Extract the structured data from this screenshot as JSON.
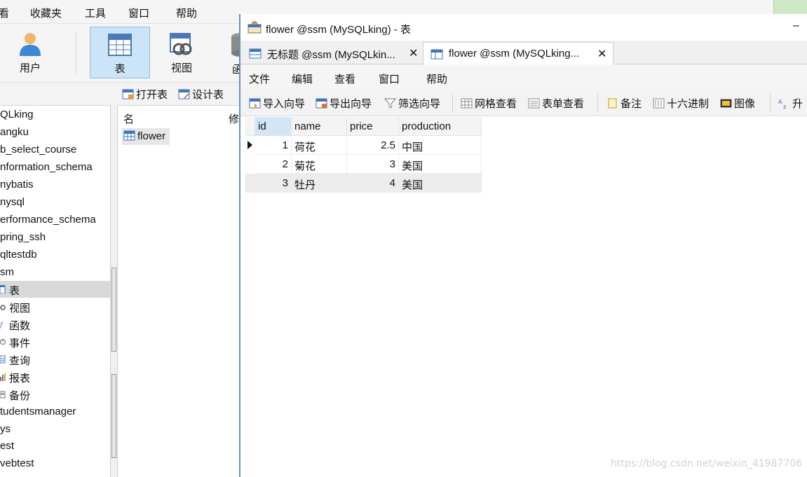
{
  "main_menu": [
    "看",
    "收藏夹",
    "工具",
    "窗口",
    "帮助"
  ],
  "main_toolbar": {
    "buttons": [
      {
        "label": "用户",
        "icon": "user-icon"
      },
      {
        "label": "表",
        "icon": "table-icon"
      },
      {
        "label": "视图",
        "icon": "view-icon"
      },
      {
        "label": "函",
        "icon": "function-icon"
      }
    ]
  },
  "sub_toolbar": {
    "open_table": "打开表",
    "design_table": "设计表"
  },
  "tree": {
    "items": [
      {
        "label": "QLking"
      },
      {
        "label": "angku"
      },
      {
        "label": "b_select_course"
      },
      {
        "label": "nformation_schema"
      },
      {
        "label": "nybatis"
      },
      {
        "label": "nysql"
      },
      {
        "label": "erformance_schema"
      },
      {
        "label": "pring_ssh"
      },
      {
        "label": "qltestdb"
      },
      {
        "label": "sm"
      },
      {
        "label": "表",
        "icon": "table-icon",
        "selected": true
      },
      {
        "label": "视图",
        "icon": "view-icon"
      },
      {
        "label": "函数",
        "icon": "function-icon"
      },
      {
        "label": "事件",
        "icon": "event-icon"
      },
      {
        "label": "查询",
        "icon": "query-icon"
      },
      {
        "label": "报表",
        "icon": "report-icon"
      },
      {
        "label": "备份",
        "icon": "backup-icon"
      },
      {
        "label": "tudentsmanager"
      },
      {
        "label": "ys"
      },
      {
        "label": "est"
      },
      {
        "label": "vebtest"
      }
    ]
  },
  "object_list": {
    "col_name": "名",
    "col_modified": "修",
    "items": [
      {
        "label": "flower",
        "icon": "table-icon"
      }
    ]
  },
  "table_window": {
    "title": "flower @ssm (MySQLking) - 表",
    "min_glyph": "–",
    "tabs": [
      {
        "label": "无标题 @ssm (MySQLkin...",
        "close": "✕"
      },
      {
        "label": "flower @ssm (MySQLking...",
        "close": "✕",
        "active": true
      }
    ],
    "menu": [
      "文件",
      "编辑",
      "查看",
      "窗口",
      "帮助"
    ],
    "toolbar": {
      "import_wizard": "导入向导",
      "export_wizard": "导出向导",
      "filter_wizard": "筛选向导",
      "grid_view": "网格查看",
      "form_view": "表单查看",
      "memo": "备注",
      "hex": "十六进制",
      "image": "图像",
      "sort_asc": "升"
    },
    "grid": {
      "columns": [
        "id",
        "name",
        "price",
        "production"
      ],
      "rows": [
        [
          "1",
          "荷花",
          "2.5",
          "中国"
        ],
        [
          "2",
          "菊花",
          "3",
          "美国"
        ],
        [
          "3",
          "牡丹",
          "4",
          "美国"
        ]
      ]
    }
  },
  "watermark": "https://blog.csdn.net/weixin_41987706",
  "colors": {
    "selection_blue": "#cce4f7",
    "window_border": "#6a8ebd",
    "tree_selected": "#d9d9d9"
  }
}
